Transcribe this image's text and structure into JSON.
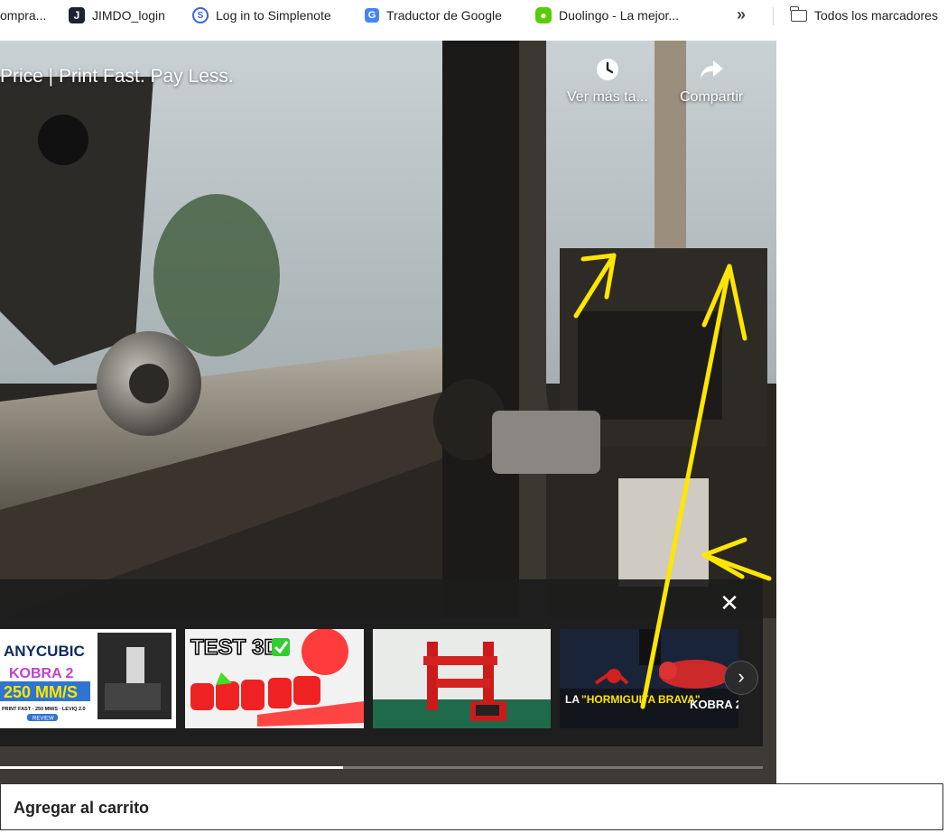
{
  "bookmarks": {
    "items": [
      {
        "label": "ompra...",
        "icon": "bookmark-favicon"
      },
      {
        "label": "JIMDO_login",
        "icon": "jimdo-icon"
      },
      {
        "label": "Log in to Simplenote",
        "icon": "simplenote-icon"
      },
      {
        "label": "Traductor de Google",
        "icon": "google-translate-icon"
      },
      {
        "label": "Duolingo - La mejor...",
        "icon": "duolingo-icon"
      }
    ],
    "more_glyph": "»",
    "all_bookmarks": "Todos los marcadores"
  },
  "video": {
    "title": "Price | Print Fast. Pay Less.",
    "watch_later": "Ver más ta...",
    "share": "Compartir",
    "progress": 0.45
  },
  "endscreen": {
    "close_glyph": "✕",
    "next_glyph": "›",
    "thumbnails": [
      {
        "label": "anycubic-kobra2-thumbnail",
        "lines": [
          "ANYCUBIC",
          "KOBRA 2",
          "250 MM/S",
          "PRINT FAST - 250 MM/S · LEVIQ 2.0",
          "REVIEW"
        ]
      },
      {
        "label": "test-3d-thumbnail",
        "lines": [
          "TEST 3D"
        ]
      },
      {
        "label": "red-printer-thumbnail",
        "lines": []
      },
      {
        "label": "hormiguita-brava-thumbnail",
        "lines": [
          "LA",
          "\"HORMIGUITA BRAVA\"",
          "KOBRA 2"
        ]
      }
    ]
  },
  "cart": {
    "label": "Agregar al carrito"
  },
  "colors": {
    "annotation": "#ffe600",
    "panel": "#1c1c1c",
    "accent_red": "#e02020"
  }
}
